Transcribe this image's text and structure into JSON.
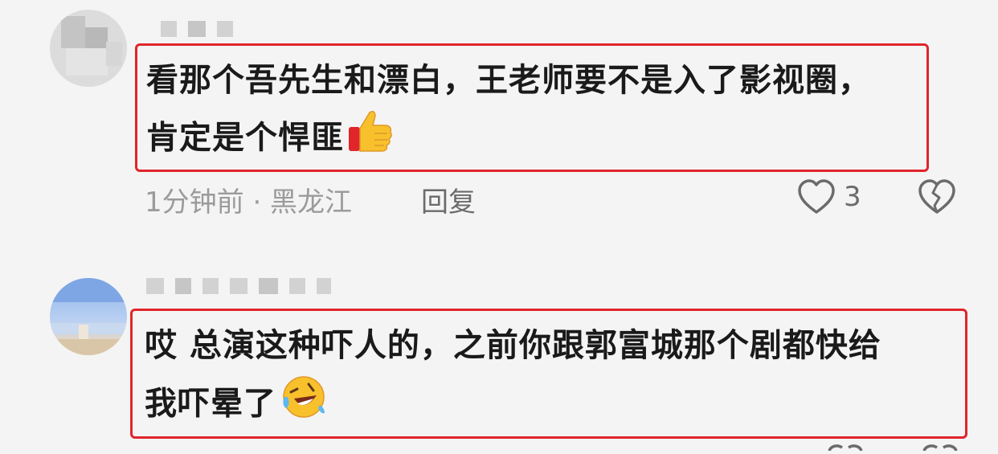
{
  "comments": [
    {
      "text_line1": "看那个吾先生和漂白，王老师要不是入了影视圈，",
      "text_line2": "肯定是个悍匪",
      "emoji": "thumbs-up",
      "time_location": "1分钟前 · 黑龙江",
      "reply_label": "回复",
      "like_count": "3"
    },
    {
      "text_line1": "哎 总演这种吓人的，之前你跟郭富城那个剧都快给",
      "text_line2": "我吓晕了",
      "emoji": "rolling-laughing-face"
    }
  ],
  "colors": {
    "highlight": "#e0252b",
    "background": "#f4f4f4",
    "text": "#1a1a1a",
    "meta": "#9b9b9b"
  }
}
